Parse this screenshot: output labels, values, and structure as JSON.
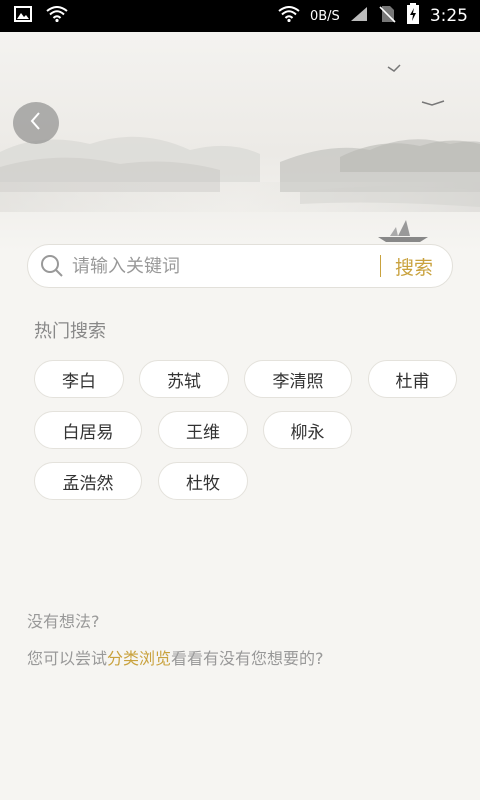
{
  "status_bar": {
    "network_speed": "0B/S",
    "time": "3:25",
    "icons": [
      "image-icon",
      "wifi-icon",
      "wifi-icon",
      "signal-icon",
      "no-sim-icon",
      "battery-charging-icon"
    ]
  },
  "header": {
    "back_icon": "chevron-left-icon"
  },
  "search": {
    "placeholder": "请输入关键词",
    "button_label": "搜索",
    "accent_color": "#c9a23e"
  },
  "hot_searches": {
    "title": "热门搜索",
    "tags": [
      "李白",
      "苏轼",
      "李清照",
      "杜甫",
      "白居易",
      "王维",
      "柳永",
      "孟浩然",
      "杜牧"
    ]
  },
  "suggestion": {
    "title": "没有想法?",
    "prefix": "您可以尝试",
    "link": "分类浏览",
    "suffix": "看看有没有您想要的?"
  }
}
